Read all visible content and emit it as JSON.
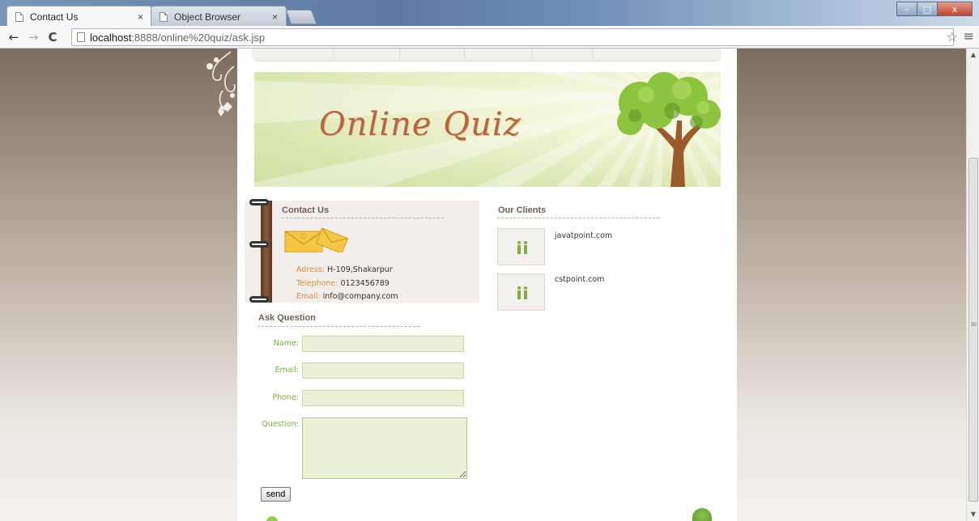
{
  "browser": {
    "tabs": [
      {
        "label": "Contact Us",
        "active": true
      },
      {
        "label": "Object Browser",
        "active": false
      }
    ],
    "window_controls": {
      "minimize": "–",
      "maximize": "□",
      "close": "x"
    },
    "nav": {
      "back": "←",
      "forward": "→",
      "reload": "C"
    },
    "url": {
      "host": "localhost",
      "path": ":8888/online%20quiz/ask.jsp"
    },
    "star": "☆",
    "menu": "≡"
  },
  "banner": {
    "title": "Online Quiz"
  },
  "contact": {
    "title": "Contact Us",
    "address_label": "Adress:",
    "address": "H-109,Shakarpur",
    "telephone_label": "Telephone:",
    "telephone": "0123456789",
    "email_label": "Email:",
    "email": "info@company.com"
  },
  "clients": {
    "title": "Our Clients",
    "items": [
      {
        "name": "javatpoint.com"
      },
      {
        "name": "cstpoint.com"
      }
    ]
  },
  "ask": {
    "title": "Ask Question",
    "name_label": "Name:",
    "email_label": "Email:",
    "phone_label": "Phone:",
    "question_label": "Question:",
    "name_value": "",
    "email_value": "",
    "phone_value": "",
    "question_value": "",
    "send_label": "send"
  },
  "colors": {
    "label_green": "#7fae3d",
    "contact_label_orange": "#e18d3b",
    "input_bg": "#ebf1d6",
    "title_brown": "#b5663f"
  }
}
